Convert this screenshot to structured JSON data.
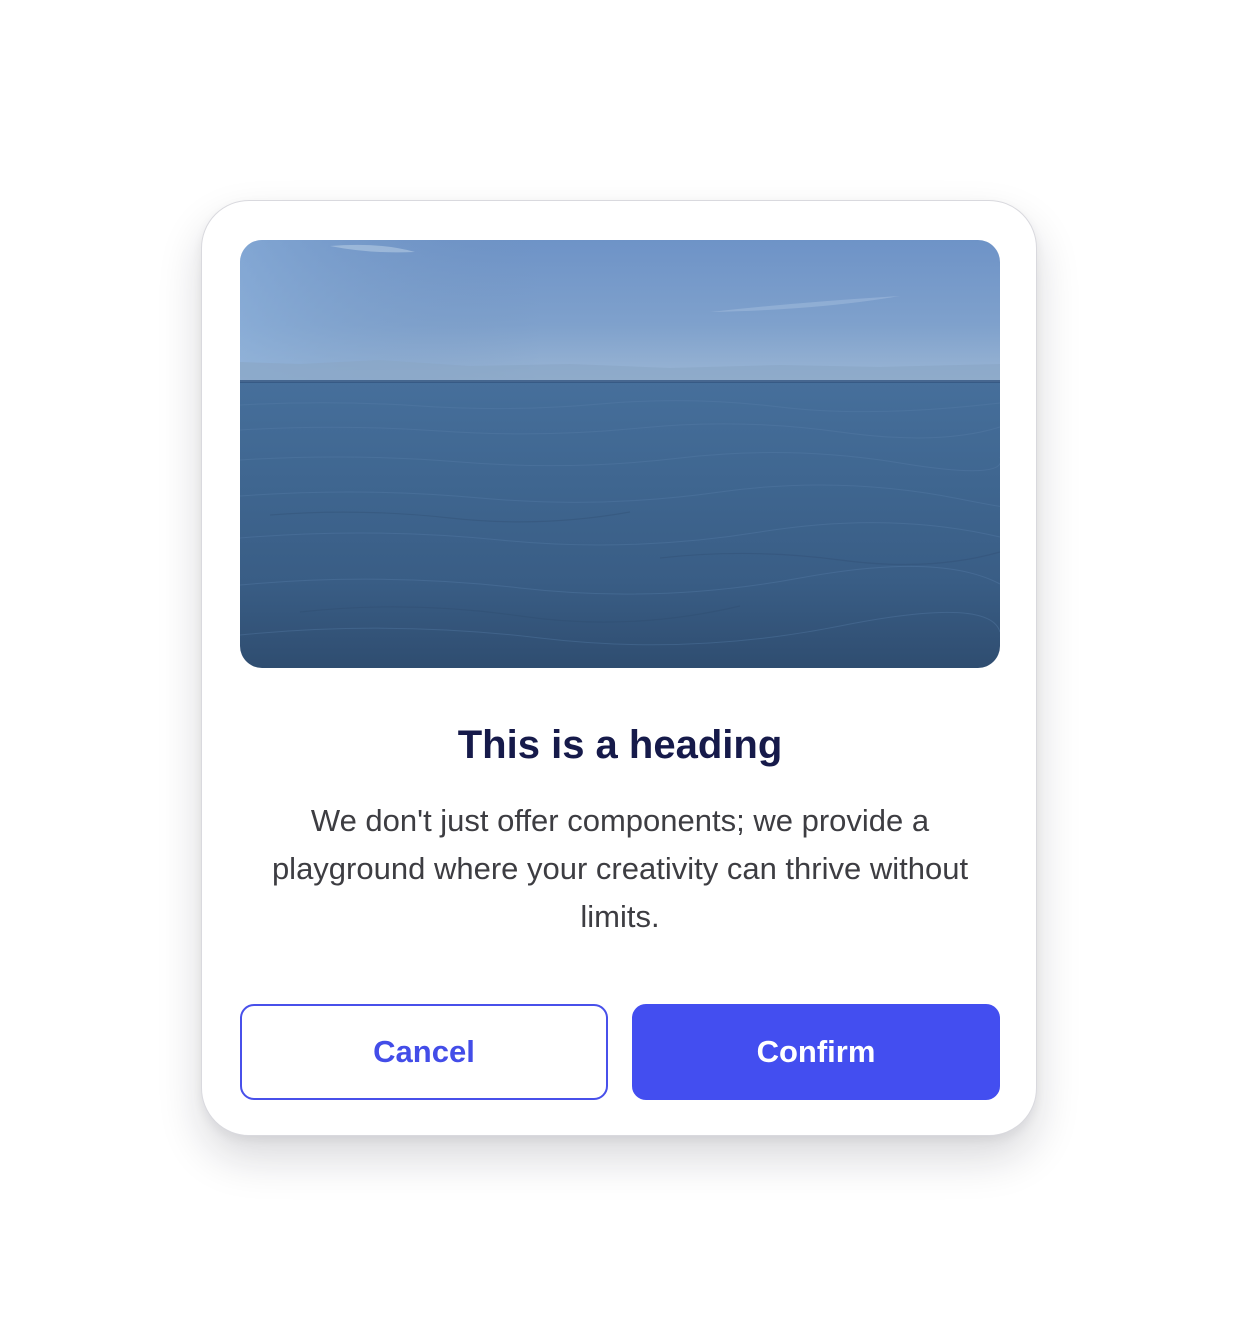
{
  "modal": {
    "image": {
      "description_icon": "ocean-horizon-image"
    },
    "heading": "This is a heading",
    "body": "We don't just offer components; we provide a playground where your creativity can thrive without limits.",
    "actions": {
      "cancel_label": "Cancel",
      "confirm_label": "Confirm"
    }
  },
  "colors": {
    "primary": "#434EF0",
    "heading": "#161A4A",
    "body_text": "#3D3D42",
    "cancel_text": "#434DE8",
    "card_border": "#D9D9DE"
  }
}
